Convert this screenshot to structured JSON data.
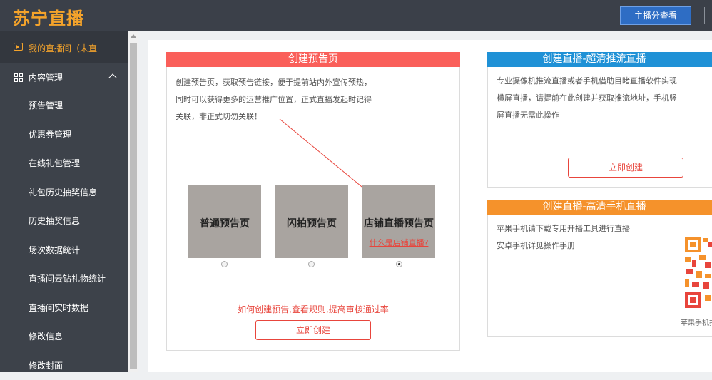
{
  "header": {
    "logo": "苏宁直播",
    "anchor_button": "主播分查看"
  },
  "sidebar": {
    "active_item": "我的直播间（未直",
    "group_label": "内容管理",
    "items": [
      "预告管理",
      "优惠券管理",
      "在线礼包管理",
      "礼包历史抽奖信息",
      "历史抽奖信息",
      "场次数据统计",
      "直播间云钻礼物统计",
      "直播间实时数据",
      "修改信息",
      "修改封面"
    ]
  },
  "preview_card": {
    "title": "创建预告页",
    "desc_lines": [
      "创建预告页，获取预告链接，便于提前站内外宣传预热，",
      "同时可以获得更多的运营推广位置，正式直播发起时记得",
      "关联，非正式切勿关联！"
    ],
    "options": [
      {
        "label": "普通预告页",
        "selected": false
      },
      {
        "label": "闪拍预告页",
        "selected": false
      },
      {
        "label": "店铺直播预告页",
        "selected": true,
        "link": "什么是店铺直播?"
      }
    ],
    "help_link": "如何创建预告,查看规则,提高审核通过率",
    "create_button": "立即创建"
  },
  "push_card": {
    "title": "创建直播-超清推流直播",
    "desc_lines": [
      "专业摄像机推流直播或者手机借助目睹直播软件实现",
      "横屏直播，请提前在此创建并获取推流地址，手机竖",
      "屏直播无需此操作"
    ],
    "create_button": "立即创建"
  },
  "mobile_card": {
    "title": "创建直播-高清手机直播",
    "desc_lines": [
      "苹果手机请下载专用开播工具进行直播",
      "安卓手机详见操作手册"
    ],
    "qr_caption": "苹果手机扫"
  },
  "colors": {
    "preview_header": "#fa5f5a",
    "push_header": "#1f91d6",
    "mobile_header": "#f5922b",
    "accent": "#e8453c",
    "sidebar_active": "#f4a32b"
  }
}
